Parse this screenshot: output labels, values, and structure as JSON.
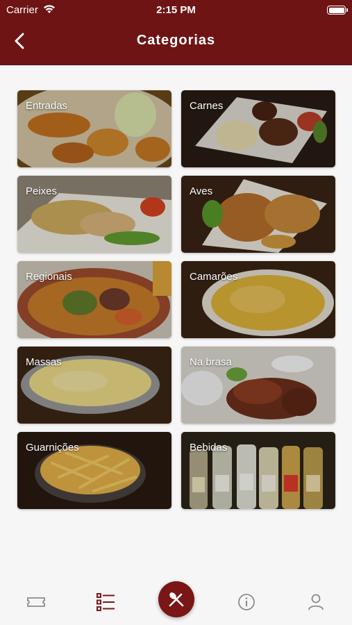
{
  "status_bar": {
    "carrier": "Carrier",
    "time": "2:15 PM"
  },
  "header": {
    "title": "Categorias"
  },
  "categories": [
    {
      "label": "Entradas"
    },
    {
      "label": "Carnes"
    },
    {
      "label": "Peixes"
    },
    {
      "label": "Aves"
    },
    {
      "label": "Regionais"
    },
    {
      "label": "Camarões"
    },
    {
      "label": "Massas"
    },
    {
      "label": "Na brasa"
    },
    {
      "label": "Guarnições"
    },
    {
      "label": "Bebidas"
    }
  ],
  "tabbar": {
    "items": [
      "ticket-icon",
      "list-icon",
      "fork-knife-icon",
      "info-icon",
      "user-icon"
    ],
    "active": "list-icon"
  },
  "colors": {
    "brand": "#6e1414",
    "accent": "#7a1616"
  }
}
